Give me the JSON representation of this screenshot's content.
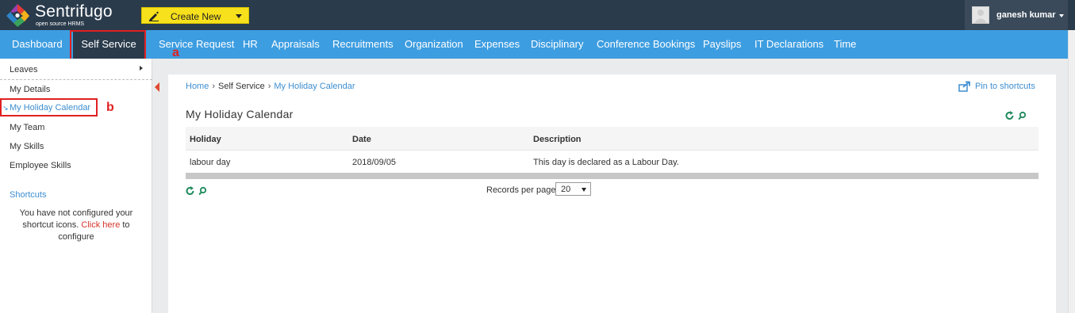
{
  "header": {
    "logo_name": "Sentrifugo",
    "logo_tagline": "open source HRMS",
    "create_new_label": "Create New",
    "user_name": "ganesh kumar"
  },
  "nav": {
    "items": [
      {
        "label": "Dashboard"
      },
      {
        "label": "Self Service"
      },
      {
        "label": "Service Request"
      },
      {
        "label": "HR"
      },
      {
        "label": "Appraisals"
      },
      {
        "label": "Recruitments"
      },
      {
        "label": "Organization"
      },
      {
        "label": "Expenses"
      },
      {
        "label": "Disciplinary"
      },
      {
        "label": "Conference Bookings"
      },
      {
        "label": "Payslips"
      },
      {
        "label": "IT Declarations"
      },
      {
        "label": "Time"
      }
    ],
    "active": "Self Service"
  },
  "annotations": {
    "a": "a",
    "b": "b"
  },
  "sidebar": {
    "items": [
      {
        "label": "Leaves"
      },
      {
        "label": "My Details"
      },
      {
        "label": "My Holiday Calendar"
      },
      {
        "label": "My Team"
      },
      {
        "label": "My Skills"
      },
      {
        "label": "Employee Skills"
      }
    ],
    "selected": "My Holiday Calendar",
    "shortcuts_title": "Shortcuts",
    "shortcuts_msg_1": "You have not configured your shortcut icons.",
    "shortcuts_link": "Click here",
    "shortcuts_msg_2": "to configure"
  },
  "breadcrumb": {
    "home": "Home",
    "section": "Self Service",
    "current": "My Holiday Calendar"
  },
  "pin_label": "Pin to shortcuts",
  "page_title": "My Holiday Calendar",
  "table": {
    "headers": [
      "Holiday",
      "Date",
      "Description"
    ],
    "rows": [
      [
        "labour day",
        "2018/09/05",
        "This day is declared as a Labour Day."
      ]
    ]
  },
  "pagination": {
    "records_per_page_label": "Records per page",
    "records_per_page_value": "20"
  },
  "colors": {
    "nav_bg": "#3d9de1",
    "topbar_bg": "#2a3b4c",
    "create_new_bg": "#f7e01c",
    "link": "#3d8ed0",
    "annotation": "#e02020"
  }
}
